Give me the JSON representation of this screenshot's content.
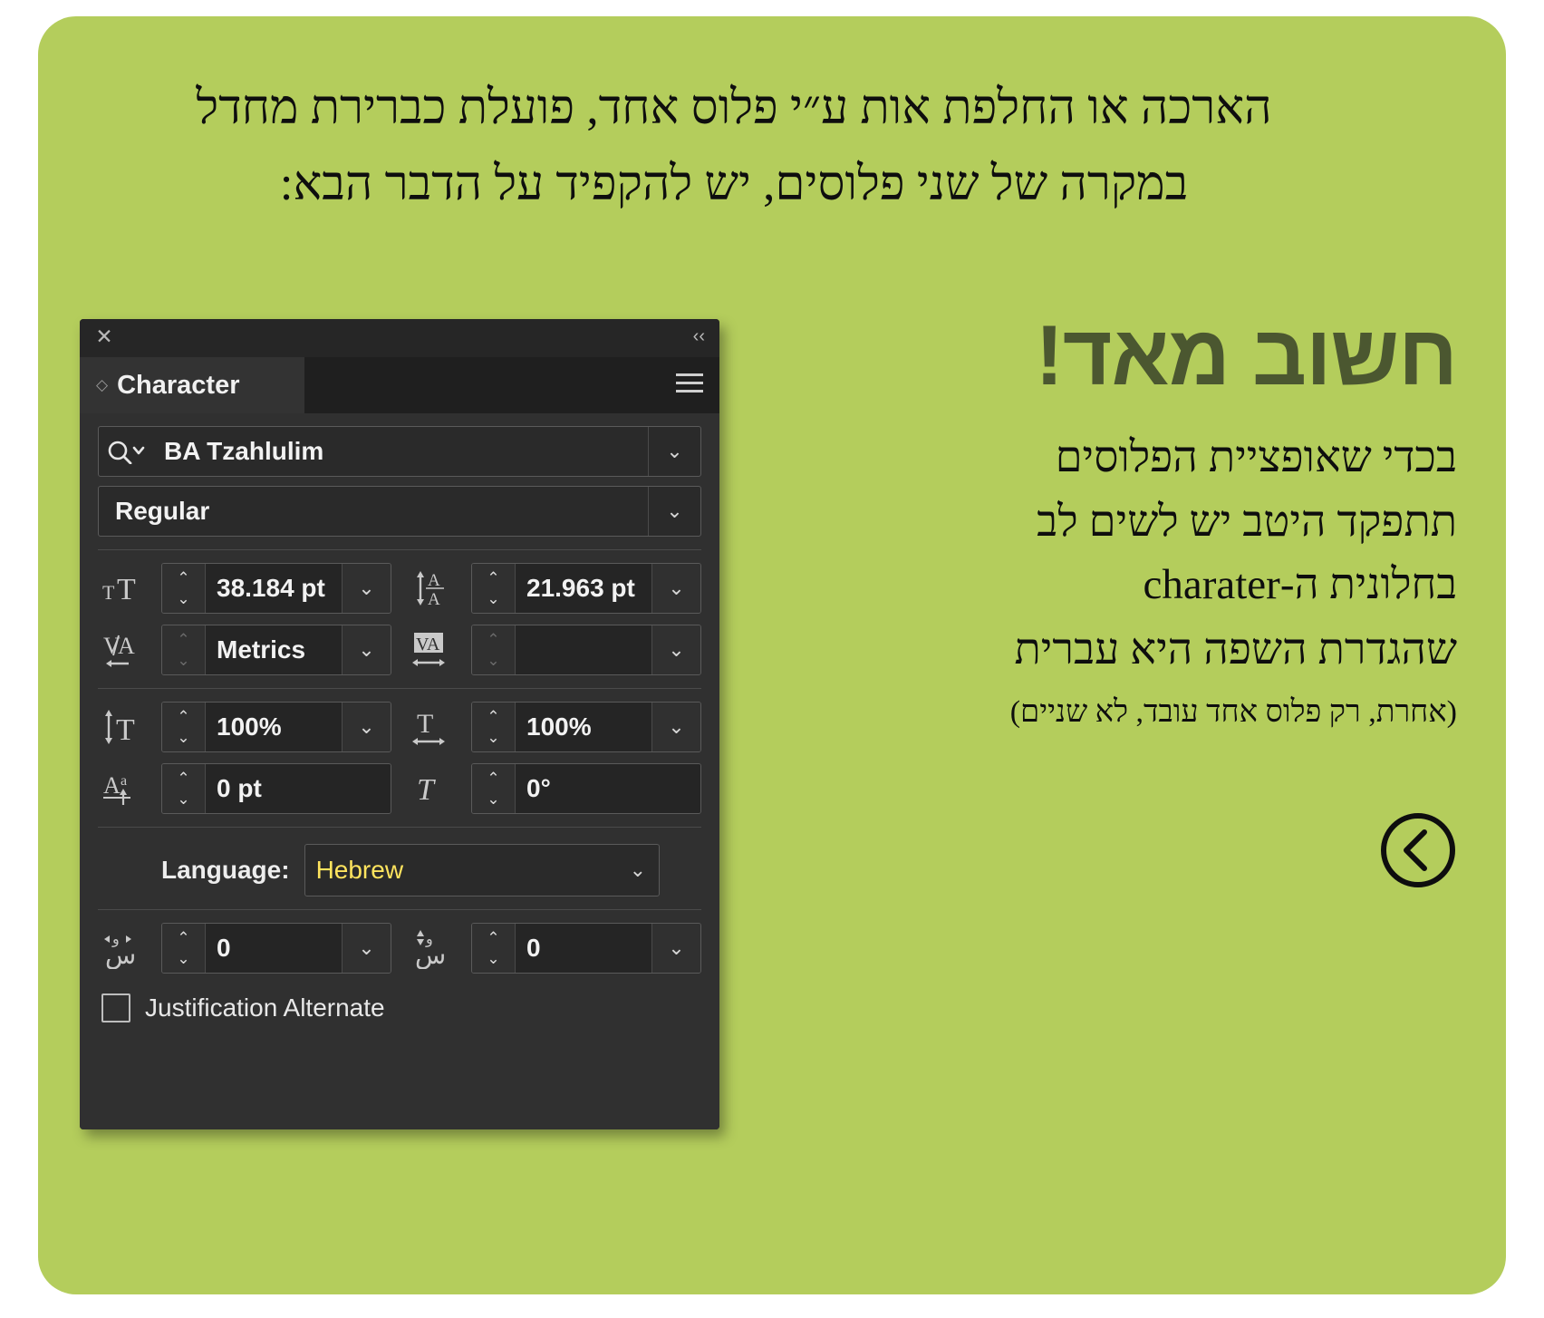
{
  "card": {
    "background_color": "#b4cd5c",
    "top_paragraph_line1": "הארכה או החלפת אות ע״י פלוס אחד, פועלת כברירת מחדל",
    "top_paragraph_line2": "במקרה של שני פלוסים, יש להקפיד על הדבר הבא:"
  },
  "right_column": {
    "heading": "חשוב מאד!",
    "heading_color": "#4b5730",
    "body_lines": [
      "בכדי שאופציית הפלוסים",
      "תתפקד היטב יש לשים לב",
      "בחלונית ה-charater",
      "שהגדרת השפה היא עברית"
    ],
    "note_line": "(אחרת, רק פלוס אחד עובד, לא שניים)",
    "back_arrow_icon": "circled-left-arrow-icon"
  },
  "character_panel": {
    "close_icon": "close-icon",
    "collapse_icon": "collapse-double-chevron-icon",
    "tab_label": "Character",
    "tab_grip_icon": "grip-diamond-icon",
    "menu_icon": "hamburger-menu-icon",
    "font_family": {
      "icon": "search-icon",
      "value": "BA Tzahlulim",
      "caret_icon": "chevron-down-icon"
    },
    "font_style": {
      "value": "Regular",
      "caret_icon": "chevron-down-icon"
    },
    "fields": [
      {
        "name": "font-size",
        "icon": "font-size-icon",
        "value": "38.184 pt",
        "has_dropdown": true,
        "stepper_enabled": true
      },
      {
        "name": "leading",
        "icon": "leading-icon",
        "value": "21.963 pt",
        "has_dropdown": true,
        "stepper_enabled": true
      },
      {
        "name": "kerning",
        "icon": "kerning-icon",
        "value": "Metrics",
        "has_dropdown": true,
        "stepper_enabled": false
      },
      {
        "name": "tracking",
        "icon": "tracking-icon",
        "value": "",
        "has_dropdown": true,
        "stepper_enabled": false
      },
      {
        "name": "vertical-scale",
        "icon": "vertical-scale-icon",
        "value": "100%",
        "has_dropdown": true,
        "stepper_enabled": true
      },
      {
        "name": "horizontal-scale",
        "icon": "horizontal-scale-icon",
        "value": "100%",
        "has_dropdown": true,
        "stepper_enabled": true
      },
      {
        "name": "baseline-shift",
        "icon": "baseline-shift-icon",
        "value": "0 pt",
        "has_dropdown": false,
        "stepper_enabled": true
      },
      {
        "name": "character-rotation",
        "icon": "character-rotation-icon",
        "value": "0°",
        "has_dropdown": false,
        "stepper_enabled": true
      }
    ],
    "language": {
      "label": "Language:",
      "value": "Hebrew",
      "value_color": "#ffe45e",
      "caret_icon": "chevron-down-icon"
    },
    "arabic_fields": [
      {
        "name": "tatweel-horizontal",
        "icon": "arabic-tatweel-horizontal-icon",
        "value": "0",
        "has_dropdown": true
      },
      {
        "name": "tatweel-vertical",
        "icon": "arabic-tatweel-vertical-icon",
        "value": "0",
        "has_dropdown": true
      }
    ],
    "justification_alternate": {
      "label": "Justification Alternate",
      "checked": false
    },
    "cursor_icon": "mouse-pointer-cursor"
  }
}
